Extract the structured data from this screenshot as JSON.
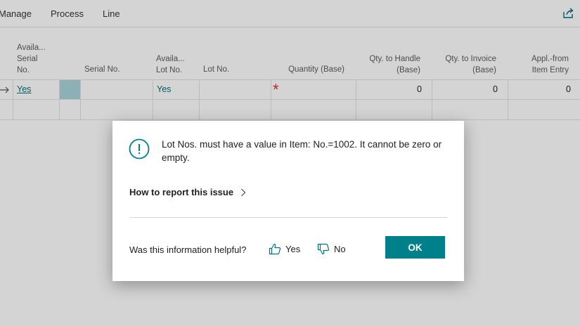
{
  "menu": {
    "manage": "Manage",
    "process": "Process",
    "line": "Line"
  },
  "icons": {
    "share": "share-icon",
    "row_arrow": "arrow-right-icon",
    "required": "asterisk-icon",
    "info": "info-icon",
    "chevron": "chevron-right-icon",
    "thumbs_up": "thumbs-up-icon",
    "thumbs_down": "thumbs-down-icon"
  },
  "colors": {
    "accent": "#00727a",
    "ok_button": "#00808a",
    "required": "#d13438",
    "selected_cell": "#a8d4da"
  },
  "table": {
    "headers": {
      "avail_serial": [
        "Availa...",
        "Serial",
        "No."
      ],
      "serial_no": "Serial No.",
      "avail_lot": [
        "Availa...",
        "Lot No."
      ],
      "lot_no": "Lot No.",
      "quantity_base": "Quantity (Base)",
      "qty_handle": [
        "Qty. to Handle",
        "(Base)"
      ],
      "qty_invoice": [
        "Qty. to Invoice",
        "(Base)"
      ],
      "appl_from": [
        "Appl.-from",
        "Item Entry"
      ]
    },
    "row": {
      "avail_serial": "Yes",
      "avail_lot": "Yes",
      "required_mark": "*",
      "qty_handle": "0",
      "qty_invoice": "0",
      "appl_from": "0"
    }
  },
  "dialog": {
    "message": "Lot Nos. must have a value in Item: No.=1002. It cannot be zero or empty.",
    "report_link": "How to report this issue",
    "helpful_question": "Was this information helpful?",
    "yes": "Yes",
    "no": "No",
    "ok": "OK"
  }
}
